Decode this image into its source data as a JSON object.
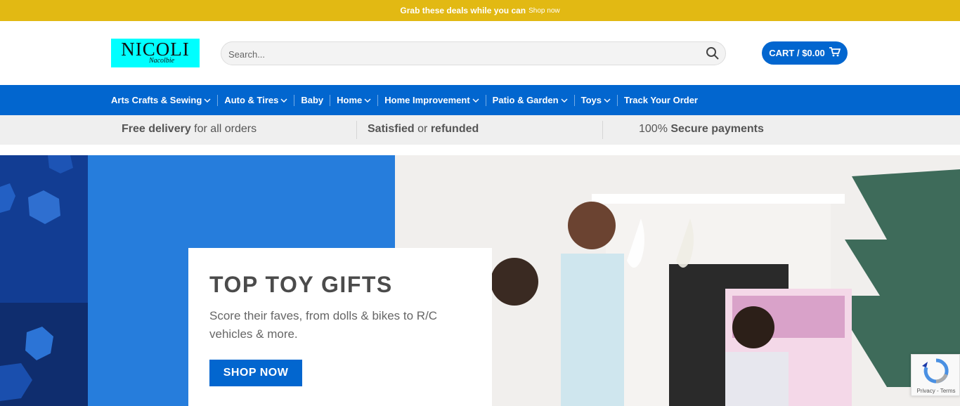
{
  "promo": {
    "text": "Grab these deals while you can",
    "link": "Shop now"
  },
  "logo": {
    "name": "NICOLI",
    "tagline": "Nacolbie"
  },
  "search": {
    "placeholder": "Search..."
  },
  "cart": {
    "label": "CART / $0.00"
  },
  "nav": [
    {
      "label": "Arts Crafts & Sewing",
      "dropdown": true
    },
    {
      "label": "Auto & Tires",
      "dropdown": true
    },
    {
      "label": "Baby",
      "dropdown": false
    },
    {
      "label": "Home",
      "dropdown": true
    },
    {
      "label": "Home Improvement",
      "dropdown": true
    },
    {
      "label": "Patio & Garden",
      "dropdown": true
    },
    {
      "label": "Toys",
      "dropdown": true
    },
    {
      "label": "Track Your Order",
      "dropdown": false
    }
  ],
  "features": {
    "delivery": {
      "bold": "Free delivery",
      "rest": " for all orders"
    },
    "satisfied": {
      "bold1": "Satisfied",
      "mid": " or ",
      "bold2": "refunded"
    },
    "secure": {
      "pre": "100% ",
      "bold": "Secure payments"
    }
  },
  "hero": {
    "title": "TOP TOY GIFTS",
    "subtitle": "Score their faves, from dolls & bikes to R/C vehicles & more.",
    "button": "SHOP NOW"
  },
  "recaptcha": {
    "text": "Privacy - Terms"
  },
  "colors": {
    "promo_bar": "#e2b913",
    "brand_blue": "#0266cf",
    "logo_bg": "#00ffff"
  }
}
